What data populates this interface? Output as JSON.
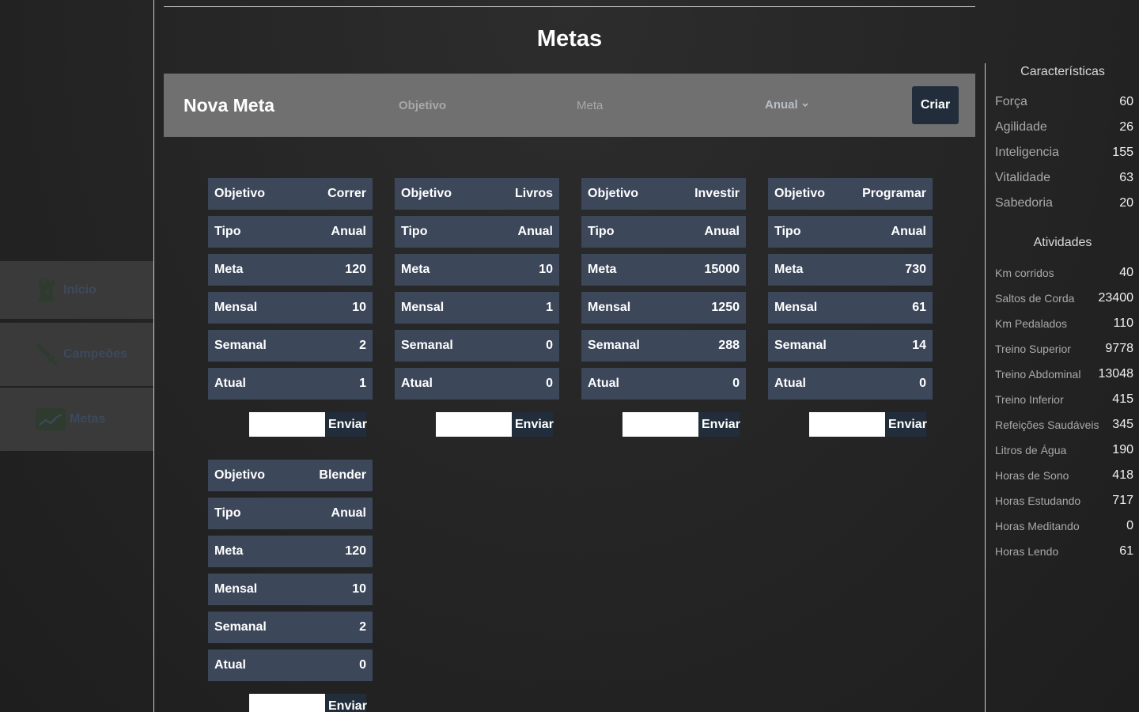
{
  "nav": {
    "items": [
      {
        "label": "Início",
        "icon": "castle-icon"
      },
      {
        "label": "Campeões",
        "icon": "sword-icon"
      },
      {
        "label": "Metas",
        "icon": "chart-icon"
      }
    ]
  },
  "page": {
    "title": "Metas"
  },
  "new_goal": {
    "title": "Nova Meta",
    "objective_placeholder": "Objetivo",
    "goal_placeholder": "Meta",
    "type_selected": "Anual",
    "create_label": "Criar"
  },
  "labels": {
    "objective": "Objetivo",
    "type": "Tipo",
    "goal": "Meta",
    "monthly": "Mensal",
    "weekly": "Semanal",
    "current": "Atual",
    "send": "Enviar"
  },
  "goals": [
    {
      "objective": "Correr",
      "type": "Anual",
      "goal": "120",
      "monthly": "10",
      "weekly": "2",
      "current": "1"
    },
    {
      "objective": "Livros",
      "type": "Anual",
      "goal": "10",
      "monthly": "1",
      "weekly": "0",
      "current": "0"
    },
    {
      "objective": "Investir",
      "type": "Anual",
      "goal": "15000",
      "monthly": "1250",
      "weekly": "288",
      "current": "0"
    },
    {
      "objective": "Programar",
      "type": "Anual",
      "goal": "730",
      "monthly": "61",
      "weekly": "14",
      "current": "0"
    },
    {
      "objective": "Blender",
      "type": "Anual",
      "goal": "120",
      "monthly": "10",
      "weekly": "2",
      "current": "0"
    }
  ],
  "sidebar": {
    "characteristics_title": "Características",
    "characteristics": [
      {
        "label": "Força",
        "value": "60"
      },
      {
        "label": "Agilidade",
        "value": "26"
      },
      {
        "label": "Inteligencia",
        "value": "155"
      },
      {
        "label": "Vitalidade",
        "value": "63"
      },
      {
        "label": "Sabedoria",
        "value": "20"
      }
    ],
    "activities_title": "Atividades",
    "activities": [
      {
        "label": "Km corridos",
        "value": "40"
      },
      {
        "label": "Saltos de Corda",
        "value": "23400"
      },
      {
        "label": "Km Pedalados",
        "value": "110"
      },
      {
        "label": "Treino Superior",
        "value": "9778"
      },
      {
        "label": "Treino Abdominal",
        "value": "13048"
      },
      {
        "label": "Treino Inferior",
        "value": "415"
      },
      {
        "label": "Refeições Saudáveis",
        "value": "345"
      },
      {
        "label": "Litros de Água",
        "value": "190"
      },
      {
        "label": "Horas de Sono",
        "value": "418"
      },
      {
        "label": "Horas Estudando",
        "value": "717"
      },
      {
        "label": "Horas Meditando",
        "value": "0"
      },
      {
        "label": "Horas Lendo",
        "value": "61"
      }
    ]
  },
  "colors": {
    "card_row": "#3d475a",
    "button_dark": "#222d3b",
    "nav_bg": "#3a3a3a",
    "new_goal_bg": "#707070"
  }
}
